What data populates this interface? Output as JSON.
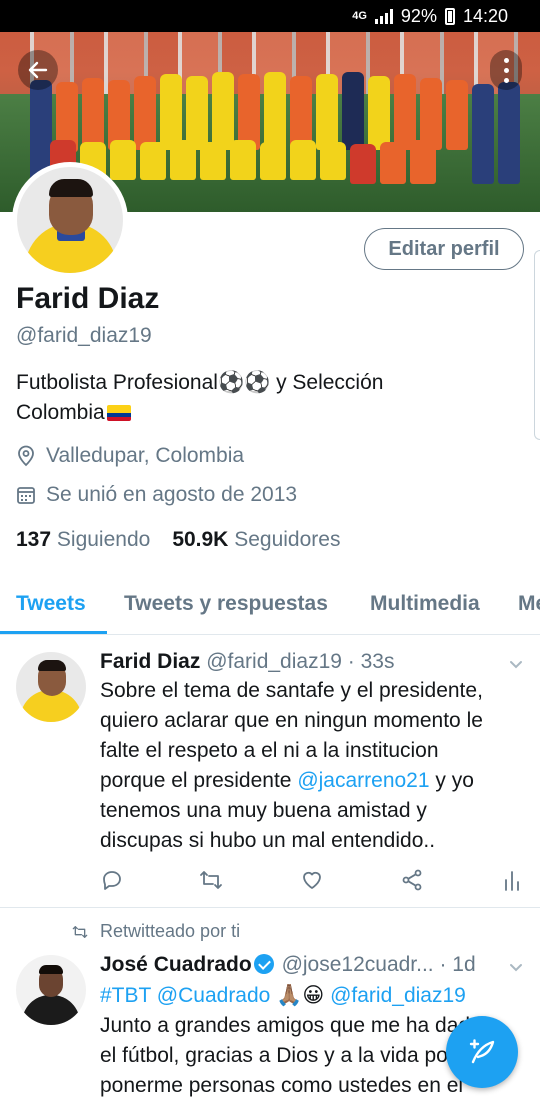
{
  "status_bar": {
    "network": "4G",
    "battery": "92%",
    "time": "14:20"
  },
  "profile": {
    "name": "Farid Diaz",
    "handle": "@farid_diaz19",
    "bio_text": "Futbolista Profesional⚽⚽ y Selección Colombia",
    "location": "Valledupar, Colombia",
    "joined": "Se unió en agosto de 2013",
    "following_count": "137",
    "following_label": "Siguiendo",
    "followers_count": "50.9K",
    "followers_label": "Seguidores",
    "edit_label": "Editar perfil"
  },
  "tabs": [
    {
      "label": "Tweets",
      "active": true
    },
    {
      "label": "Tweets y respuestas",
      "active": false
    },
    {
      "label": "Multimedia",
      "active": false
    },
    {
      "label": "Me",
      "active": false
    }
  ],
  "tweets": [
    {
      "name": "Farid Diaz",
      "handle": "@farid_diaz19",
      "time": "· 33s",
      "text_parts": {
        "line1": "Sobre el tema de santafe y el presidente,",
        "line2": "quiero aclarar que en ningun momento le",
        "line3": "falte el respeto a el ni a la institucion",
        "line4a": "porque el presidente ",
        "mention": "@jacarreno21",
        "line4b": " y yo",
        "line5": "tenemos una muy buena amistad y",
        "line6": "discupas si hubo un mal entendido.."
      }
    },
    {
      "retweet_label": "Retwitteado por ti",
      "name": "José Cuadrado",
      "handle": "@jose12cuadr...",
      "time": "· 1d",
      "text_parts": {
        "tags": "#TBT @Cuadrado",
        "emoji": "🙏🏽😀",
        "mention": "@farid_diaz19",
        "line2": "Junto a grandes amigos que me ha dado",
        "line3": "el fútbol, gracias a Dios y a la vida por",
        "line4": "ponerme personas como ustedes en el"
      }
    }
  ],
  "colors": {
    "accent": "#1da1f2",
    "secondary_text": "#657786",
    "primary_text": "#14171a"
  },
  "icons": [
    "back-arrow-icon",
    "more-vertical-icon",
    "location-pin-icon",
    "calendar-icon",
    "reply-icon",
    "retweet-icon",
    "like-icon",
    "share-icon",
    "analytics-icon",
    "chevron-down-icon",
    "verified-badge-icon",
    "compose-tweet-icon"
  ]
}
